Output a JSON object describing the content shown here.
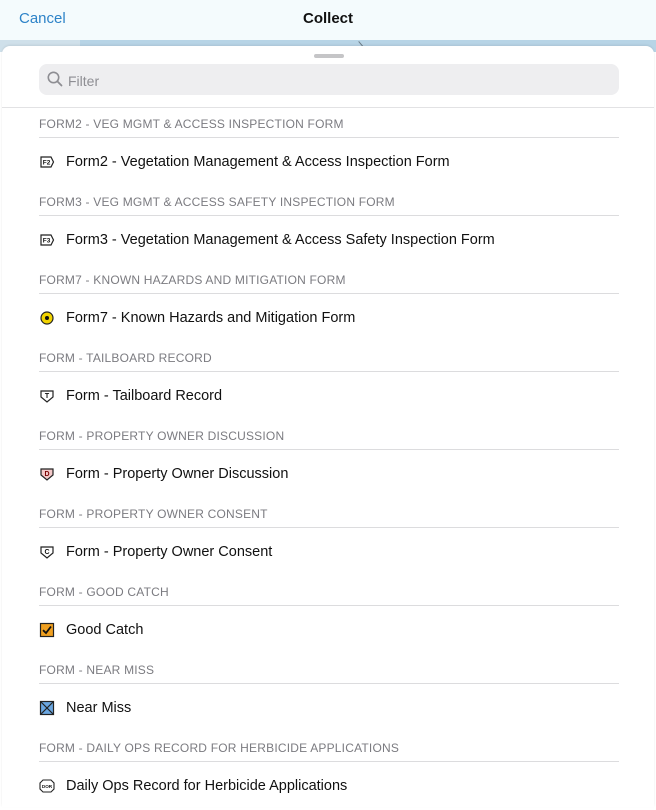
{
  "navbar": {
    "cancel_label": "Cancel",
    "title": "Collect"
  },
  "search": {
    "placeholder": "Filter",
    "value": ""
  },
  "sections": [
    {
      "header": "FORM2 - VEG MGMT & ACCESS INSPECTION FORM",
      "item": {
        "label": "Form2 - Vegetation Management & Access Inspection Form",
        "icon": "f2-badge-icon",
        "icon_text": "F2"
      }
    },
    {
      "header": "FORM3 - VEG MGMT & ACCESS SAFETY INSPECTION FORM",
      "item": {
        "label": "Form3 - Vegetation Management & Access Safety Inspection Form",
        "icon": "f3-badge-icon",
        "icon_text": "F3"
      }
    },
    {
      "header": "FORM7 - KNOWN HAZARDS AND MITIGATION FORM",
      "item": {
        "label": "Form7 - Known Hazards and Mitigation Form",
        "icon": "yellow-target-icon"
      }
    },
    {
      "header": "FORM - TAILBOARD RECORD",
      "item": {
        "label": "Form - Tailboard Record",
        "icon": "t-badge-icon",
        "icon_text": "T"
      }
    },
    {
      "header": "FORM - PROPERTY OWNER DISCUSSION",
      "item": {
        "label": "Form - Property Owner Discussion",
        "icon": "d-badge-icon",
        "icon_text": "D"
      }
    },
    {
      "header": "FORM - PROPERTY OWNER CONSENT",
      "item": {
        "label": "Form - Property Owner Consent",
        "icon": "c-badge-icon",
        "icon_text": "C"
      }
    },
    {
      "header": "FORM - GOOD CATCH",
      "item": {
        "label": "Good Catch",
        "icon": "orange-checkbox-icon"
      }
    },
    {
      "header": "FORM - NEAR MISS",
      "item": {
        "label": "Near Miss",
        "icon": "blue-crossed-box-icon"
      }
    },
    {
      "header": "FORM - DAILY OPS RECORD FOR HERBICIDE APPLICATIONS",
      "item": {
        "label": "Daily Ops Record for Herbicide Applications",
        "icon": "dor-badge-icon",
        "icon_text": "DOR"
      }
    }
  ],
  "colors": {
    "accent": "#2d83c8",
    "target_yellow": "#f2d400",
    "good_catch_orange": "#f0a020",
    "near_miss_blue": "#6aa6e0",
    "discussion_pink": "#f3c9c9"
  }
}
